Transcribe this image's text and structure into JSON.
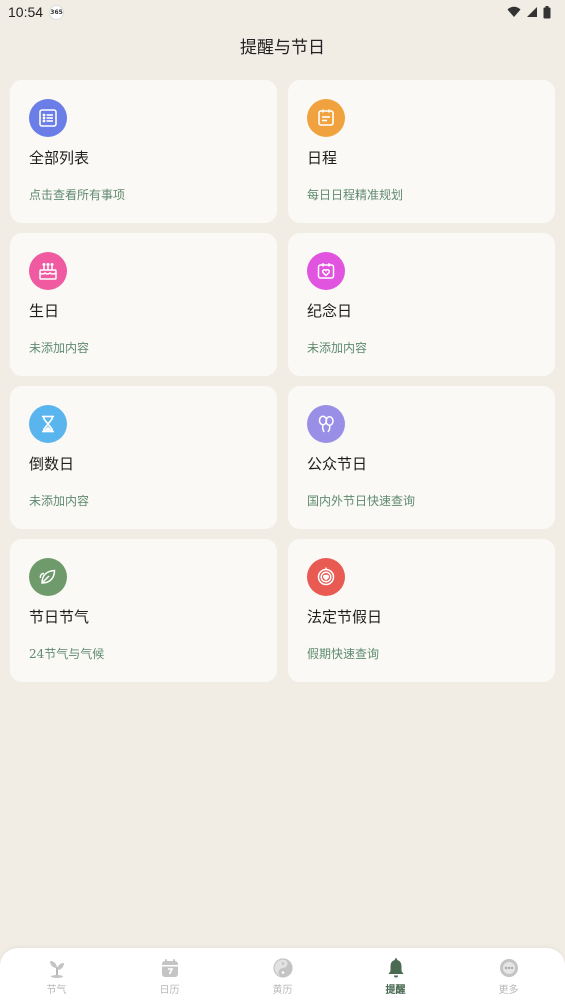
{
  "status_bar": {
    "time": "10:54",
    "app_badge": "365"
  },
  "header": {
    "title": "提醒与节日"
  },
  "cards": [
    {
      "title": "全部列表",
      "subtitle": "点击查看所有事项",
      "icon": "list-icon",
      "color": "#6b7de6"
    },
    {
      "title": "日程",
      "subtitle": "每日日程精准规划",
      "icon": "schedule-icon",
      "color": "#f0a23e"
    },
    {
      "title": "生日",
      "subtitle": "未添加内容",
      "icon": "birthday-cake-icon",
      "color": "#ef5aa0"
    },
    {
      "title": "纪念日",
      "subtitle": "未添加内容",
      "icon": "calendar-heart-icon",
      "color": "#e054e0"
    },
    {
      "title": "倒数日",
      "subtitle": "未添加内容",
      "icon": "hourglass-icon",
      "color": "#5ab5ee"
    },
    {
      "title": "公众节日",
      "subtitle": "国内外节日快速查询",
      "icon": "balloons-icon",
      "color": "#9a8fe6"
    },
    {
      "title": "节日节气",
      "subtitle": "24节气与气候",
      "icon": "leaf-icon",
      "color": "#6f9a6b"
    },
    {
      "title": "法定节假日",
      "subtitle": "假期快速查询",
      "icon": "holiday-badge-icon",
      "color": "#e85a52"
    }
  ],
  "tabbar": {
    "tabs": [
      {
        "label": "节气",
        "icon": "plant-icon",
        "active": false
      },
      {
        "label": "日历",
        "icon": "calendar-icon",
        "active": false
      },
      {
        "label": "黄历",
        "icon": "yinyang-icon",
        "active": false
      },
      {
        "label": "提醒",
        "icon": "bell-icon",
        "active": true
      },
      {
        "label": "更多",
        "icon": "more-icon",
        "active": false
      }
    ],
    "active_color": "#4a6a52",
    "inactive_color": "#b8b8b8"
  }
}
